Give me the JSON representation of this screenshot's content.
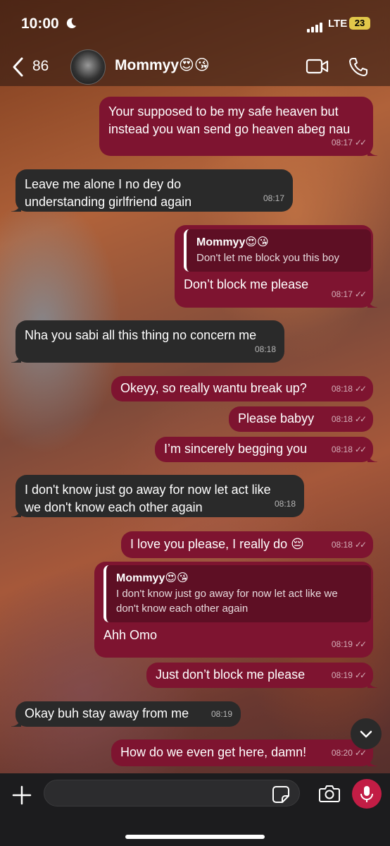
{
  "status": {
    "time": "10:00",
    "network": "LTE",
    "battery": "23"
  },
  "header": {
    "back_count": "86",
    "contact_name": "Mommyy😍😘"
  },
  "messages": [
    {
      "dir": "out",
      "text": "Your supposed to be my safe heaven but instead you wan send go heaven abeg nau",
      "time": "08:17"
    },
    {
      "dir": "in",
      "text": "Leave me alone I no dey do understanding girlfriend again",
      "time": "08:17"
    },
    {
      "dir": "out",
      "quote_name": "Mommyy😍😘",
      "quote_text": "Don't let me block you this boy",
      "text": "Don’t block me please",
      "time": "08:17"
    },
    {
      "dir": "in",
      "text": "Nha you sabi all this thing no concern me",
      "time": "08:18"
    },
    {
      "dir": "out",
      "text": "Okeyy, so really wantu break up?",
      "time": "08:18"
    },
    {
      "dir": "out",
      "text": "Please babyy",
      "time": "08:18"
    },
    {
      "dir": "out",
      "text": "I’m sincerely begging you",
      "time": "08:18"
    },
    {
      "dir": "in",
      "text": "I don't know just go away for now let act like we don't know each other again",
      "time": "08:18"
    },
    {
      "dir": "out",
      "text": "I love you please, I really do 😔",
      "time": "08:18"
    },
    {
      "dir": "out",
      "quote_name": "Mommyy😍😘",
      "quote_text": "I don't know just go away for now let act like we don't know each other again",
      "text": "Ahh Omo",
      "time": "08:19"
    },
    {
      "dir": "out",
      "text": "Just don’t block me please",
      "time": "08:19"
    },
    {
      "dir": "in",
      "text": "Okay buh stay away from me",
      "time": "08:19"
    },
    {
      "dir": "out",
      "text": "How do we even get here, damn!",
      "time": "08:20"
    }
  ],
  "composer": {
    "placeholder": ""
  },
  "colors": {
    "outgoing": "#7e1430",
    "incoming": "#2a2a2a",
    "mic": "#c21d45",
    "battery": "#e2c84a"
  },
  "icons": [
    "back-chevron-icon",
    "video-call-icon",
    "phone-icon",
    "plus-icon",
    "sticker-icon",
    "camera-icon",
    "mic-icon",
    "chevron-down-icon",
    "moon-icon"
  ]
}
